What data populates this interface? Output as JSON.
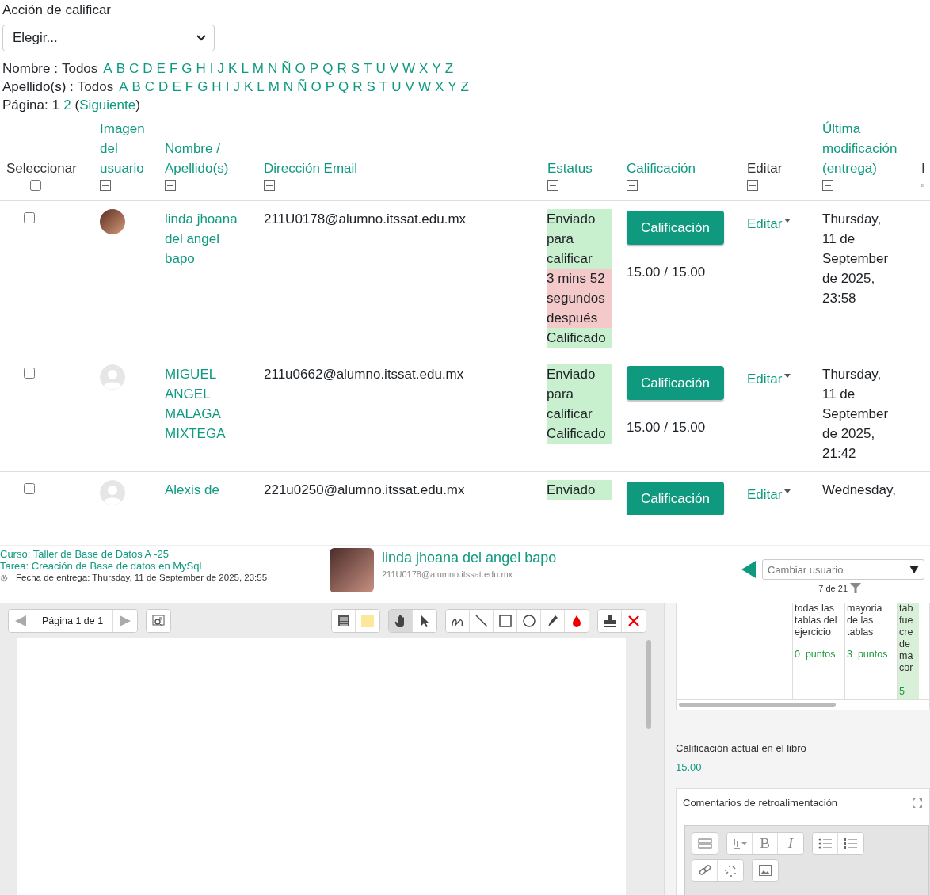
{
  "grading_action": {
    "label": "Acción de calificar",
    "select": "Elegir..."
  },
  "filters": [
    {
      "label": "Nombre :",
      "all": "Todos",
      "letters": [
        "A",
        "B",
        "C",
        "D",
        "E",
        "F",
        "G",
        "H",
        "I",
        "J",
        "K",
        "L",
        "M",
        "N",
        "Ñ",
        "O",
        "P",
        "Q",
        "R",
        "S",
        "T",
        "U",
        "V",
        "W",
        "X",
        "Y",
        "Z"
      ]
    },
    {
      "label": "Apellido(s) :",
      "all": "Todos",
      "letters": [
        "A",
        "B",
        "C",
        "D",
        "E",
        "F",
        "G",
        "H",
        "I",
        "J",
        "K",
        "L",
        "M",
        "N",
        "Ñ",
        "O",
        "P",
        "Q",
        "R",
        "S",
        "T",
        "U",
        "V",
        "W",
        "X",
        "Y",
        "Z"
      ]
    }
  ],
  "pagination": {
    "label": "Página:",
    "pages": [
      {
        "label": "1",
        "selected": true
      },
      {
        "label": "2",
        "selected": false
      }
    ],
    "open": "(",
    "next": "Siguiente",
    "close": ")"
  },
  "table": {
    "select_all": {
      "checked": false
    },
    "columns": [
      {
        "label": "Seleccionar",
        "kind": "select"
      },
      {
        "label": "Imagen del usuario",
        "kind": "link"
      },
      {
        "label": "Nombre / Apellido(s)",
        "kind": "link"
      },
      {
        "label": "Dirección Email",
        "kind": "link"
      },
      {
        "label": "Estatus",
        "kind": "link"
      },
      {
        "label": "Calificación",
        "kind": "link"
      },
      {
        "label": "Editar",
        "kind": "plain"
      },
      {
        "label": "Última modificación (entrega)",
        "kind": "link"
      },
      {
        "label": "I",
        "kind": "cut"
      }
    ],
    "rows": [
      {
        "checked": false,
        "has_photo": true,
        "name": "linda jhoana del angel bapo",
        "email": "211U0178@alumno.itssat.edu.mx",
        "status": [
          {
            "text": "Enviado para calificar",
            "kind": "submitted"
          },
          {
            "text": "3 mins 52 segundos después",
            "kind": "late"
          },
          {
            "text": "Calificado",
            "kind": "submitted"
          }
        ],
        "grade_button": "Calificación",
        "grade": "15.00 / 15.00",
        "edit": "Editar",
        "modified": "Thursday, 11 de September de 2025, 23:58"
      },
      {
        "checked": false,
        "has_photo": false,
        "name": "MIGUEL ANGEL MALAGA MIXTEGA",
        "email": "211u0662@alumno.itssat.edu.mx",
        "status": [
          {
            "text": "Enviado para calificar",
            "kind": "submitted"
          },
          {
            "text": "Calificado",
            "kind": "submitted"
          }
        ],
        "grade_button": "Calificación",
        "grade": "15.00 / 15.00",
        "edit": "Editar",
        "modified": "Thursday, 11 de September de 2025, 21:42"
      },
      {
        "checked": false,
        "has_photo": false,
        "name": "Alexis de",
        "email": "221u0250@alumno.itssat.edu.mx",
        "status": [
          {
            "text": "Enviado",
            "kind": "submitted"
          }
        ],
        "grade_button": "Calificación",
        "edit": "Editar",
        "modified": "Wednesday,"
      }
    ]
  },
  "grader": {
    "course": "Curso: Taller de Base de Datos A -25",
    "assignment": "Tarea: Creación de Base de datos en MySql",
    "due": "Fecha de entrega: Thursday, 11 de September de 2025, 23:55",
    "user": {
      "name": "linda jhoana del angel bapo",
      "email": "211U0178@alumno.itssat.edu.mx"
    },
    "change_user": {
      "placeholder": "Cambiar usuario",
      "count": "7 de 21"
    },
    "pdf_toolbar": {
      "page": "Página 1 de 1",
      "groups": [
        [
          {
            "kind": "comment",
            "selected": false
          },
          {
            "kind": "color",
            "selected": false
          }
        ],
        [
          {
            "kind": "hand",
            "selected": true
          },
          {
            "kind": "pointer",
            "selected": false
          }
        ],
        [
          {
            "kind": "pen",
            "selected": false
          },
          {
            "kind": "line",
            "selected": false
          },
          {
            "kind": "rect",
            "selected": false
          },
          {
            "kind": "oval",
            "selected": false
          },
          {
            "kind": "highlighter",
            "selected": false
          },
          {
            "kind": "drop",
            "selected": false
          }
        ],
        [
          {
            "kind": "stamp",
            "selected": false
          },
          {
            "kind": "delete",
            "selected": false
          }
        ]
      ]
    },
    "rubric": {
      "levels": [
        {
          "definition": "todas las tablas del ejercicio",
          "points": "0",
          "unit": "puntos",
          "selected": false
        },
        {
          "definition": "mayoria de las tablas",
          "points": "3",
          "unit": "puntos",
          "selected": false
        },
        {
          "definition": "tab fue cre de ma cor",
          "points": "5",
          "selected": true
        }
      ]
    },
    "gradebook": {
      "label": "Calificación actual en el libro",
      "value": "15.00"
    },
    "feedback": {
      "title": "Comentarios de retroalimentación",
      "rows": [
        [
          [
            {
              "kind": "toolbar"
            }
          ],
          [
            {
              "kind": "fontsize"
            },
            {
              "kind": "bold",
              "label": "B"
            },
            {
              "kind": "italic",
              "label": "I"
            }
          ],
          [
            {
              "kind": "bullets"
            },
            {
              "kind": "numbers"
            }
          ]
        ],
        [
          [
            {
              "kind": "link"
            },
            {
              "kind": "unlink"
            }
          ],
          [
            {
              "kind": "image"
            }
          ]
        ]
      ]
    }
  }
}
